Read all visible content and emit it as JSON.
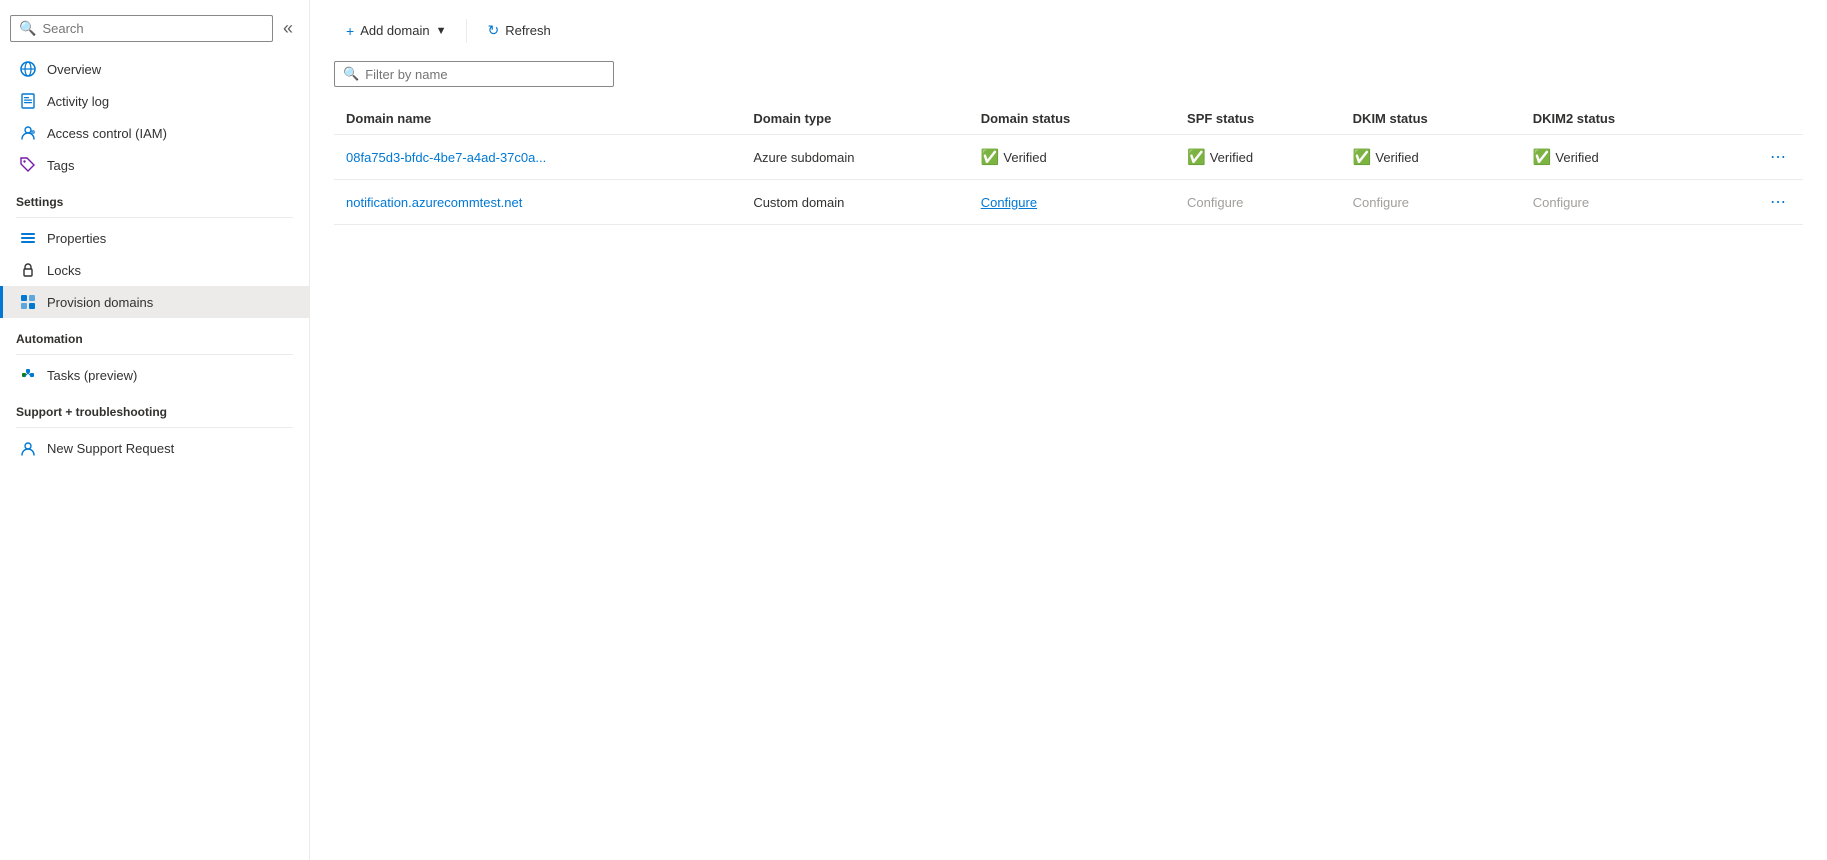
{
  "sidebar": {
    "search_placeholder": "Search",
    "nav_items": [
      {
        "id": "overview",
        "label": "Overview",
        "icon": "globe"
      },
      {
        "id": "activity-log",
        "label": "Activity log",
        "icon": "log"
      },
      {
        "id": "access-control",
        "label": "Access control (IAM)",
        "icon": "iam"
      },
      {
        "id": "tags",
        "label": "Tags",
        "icon": "tag"
      }
    ],
    "sections": [
      {
        "title": "Settings",
        "items": [
          {
            "id": "properties",
            "label": "Properties",
            "icon": "props"
          },
          {
            "id": "locks",
            "label": "Locks",
            "icon": "lock"
          },
          {
            "id": "provision-domains",
            "label": "Provision domains",
            "icon": "provision",
            "active": true
          }
        ]
      },
      {
        "title": "Automation",
        "items": [
          {
            "id": "tasks",
            "label": "Tasks (preview)",
            "icon": "tasks"
          }
        ]
      },
      {
        "title": "Support + troubleshooting",
        "items": [
          {
            "id": "new-support",
            "label": "New Support Request",
            "icon": "support"
          }
        ]
      }
    ]
  },
  "toolbar": {
    "add_domain_label": "Add domain",
    "add_domain_dropdown": true,
    "refresh_label": "Refresh"
  },
  "filter": {
    "placeholder": "Filter by name"
  },
  "table": {
    "columns": [
      {
        "id": "domain-name",
        "label": "Domain name"
      },
      {
        "id": "domain-type",
        "label": "Domain type"
      },
      {
        "id": "domain-status",
        "label": "Domain status"
      },
      {
        "id": "spf-status",
        "label": "SPF status"
      },
      {
        "id": "dkim-status",
        "label": "DKIM status"
      },
      {
        "id": "dkim2-status",
        "label": "DKIM2 status"
      }
    ],
    "rows": [
      {
        "domain_name": "08fa75d3-bfdc-4be7-a4ad-37c0a...",
        "domain_type": "Azure subdomain",
        "domain_status": "Verified",
        "domain_status_type": "verified",
        "spf_status": "Verified",
        "spf_status_type": "verified",
        "dkim_status": "Verified",
        "dkim_status_type": "verified",
        "dkim2_status": "Verified",
        "dkim2_status_type": "verified"
      },
      {
        "domain_name": "notification.azurecommtest.net",
        "domain_type": "Custom domain",
        "domain_status": "Configure",
        "domain_status_type": "configure-link",
        "spf_status": "Configure",
        "spf_status_type": "configure-gray",
        "dkim_status": "Configure",
        "dkim_status_type": "configure-gray",
        "dkim2_status": "Configure",
        "dkim2_status_type": "configure-gray"
      }
    ]
  }
}
